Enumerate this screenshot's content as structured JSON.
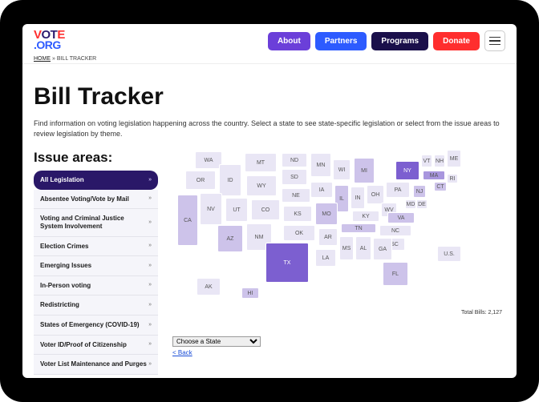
{
  "logo": {
    "part1": "V",
    "part2": "OT",
    "part3": "E",
    "part4": ".ORG"
  },
  "nav": {
    "about": "About",
    "partners": "Partners",
    "programs": "Programs",
    "donate": "Donate"
  },
  "breadcrumb": {
    "home": "HOME",
    "sep": "»",
    "current": "BILL TRACKER"
  },
  "page": {
    "title": "Bill Tracker",
    "intro": "Find information on voting legislation happening across the country. Select a state to see state-specific legislation or select from the issue areas to review legislation by theme."
  },
  "sidebar": {
    "heading": "Issue areas:",
    "items": [
      "All Legislation",
      "Absentee Voting/Vote by Mail",
      "Voting and Criminal Justice System Involvement",
      "Election Crimes",
      "Emerging Issues",
      "In-Person voting",
      "Redistricting",
      "States of Emergency (COVID-19)",
      "Voter ID/Proof of Citizenship",
      "Voter List Maintenance and Purges"
    ]
  },
  "map": {
    "states": [
      "WA",
      "OR",
      "ID",
      "MT",
      "ND",
      "MN",
      "WI",
      "MI",
      "NY",
      "VT",
      "NH",
      "ME",
      "MA",
      "RI",
      "CT",
      "NJ",
      "DE",
      "MD",
      "PA",
      "OH",
      "IN",
      "IL",
      "IA",
      "SD",
      "WY",
      "NE",
      "NV",
      "UT",
      "CO",
      "KS",
      "MO",
      "KY",
      "WV",
      "VA",
      "CA",
      "AZ",
      "NM",
      "OK",
      "AR",
      "TN",
      "NC",
      "SC",
      "TX",
      "LA",
      "MS",
      "AL",
      "GA",
      "FL",
      "AK",
      "HI",
      "U.S."
    ],
    "select_placeholder": "Choose a State",
    "back": "< Back",
    "total_label": "Total Bills: 2,127"
  }
}
